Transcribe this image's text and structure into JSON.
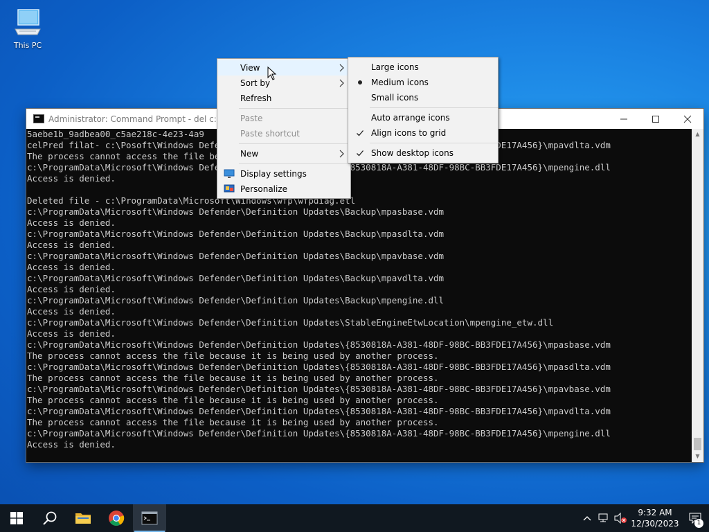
{
  "desktop": {
    "icons": [
      {
        "label": "This PC",
        "icon": "this-pc-icon"
      }
    ]
  },
  "cmd_window": {
    "title": "Administrator: Command Prompt - del  c:\\ /f /",
    "lines": [
      "5aebe1b_9adbea00_c5ae218c-4e23-4a9",
      "celPred filat- c:\\Posoft\\Windows Defender\\Definition Updates\\{8530818A-A381-48DF-98BC-BB3FDE17A456}\\mpavdlta.vdm",
      "The process cannot access the file because it is being used by another process.",
      "c:\\ProgramData\\Microsoft\\Windows Defender\\Definition Updates\\{8530818A-A381-48DF-98BC-BB3FDE17A456}\\mpengine.dll",
      "Access is denied.",
      "",
      "Deleted file - c:\\ProgramData\\Microsoft\\Windows\\wfp\\wfpdiag.etl",
      "c:\\ProgramData\\Microsoft\\Windows Defender\\Definition Updates\\Backup\\mpasbase.vdm",
      "Access is denied.",
      "c:\\ProgramData\\Microsoft\\Windows Defender\\Definition Updates\\Backup\\mpasdlta.vdm",
      "Access is denied.",
      "c:\\ProgramData\\Microsoft\\Windows Defender\\Definition Updates\\Backup\\mpavbase.vdm",
      "Access is denied.",
      "c:\\ProgramData\\Microsoft\\Windows Defender\\Definition Updates\\Backup\\mpavdlta.vdm",
      "Access is denied.",
      "c:\\ProgramData\\Microsoft\\Windows Defender\\Definition Updates\\Backup\\mpengine.dll",
      "Access is denied.",
      "c:\\ProgramData\\Microsoft\\Windows Defender\\Definition Updates\\StableEngineEtwLocation\\mpengine_etw.dll",
      "Access is denied.",
      "c:\\ProgramData\\Microsoft\\Windows Defender\\Definition Updates\\{8530818A-A381-48DF-98BC-BB3FDE17A456}\\mpasbase.vdm",
      "The process cannot access the file because it is being used by another process.",
      "c:\\ProgramData\\Microsoft\\Windows Defender\\Definition Updates\\{8530818A-A381-48DF-98BC-BB3FDE17A456}\\mpasdlta.vdm",
      "The process cannot access the file because it is being used by another process.",
      "c:\\ProgramData\\Microsoft\\Windows Defender\\Definition Updates\\{8530818A-A381-48DF-98BC-BB3FDE17A456}\\mpavbase.vdm",
      "The process cannot access the file because it is being used by another process.",
      "c:\\ProgramData\\Microsoft\\Windows Defender\\Definition Updates\\{8530818A-A381-48DF-98BC-BB3FDE17A456}\\mpavdlta.vdm",
      "The process cannot access the file because it is being used by another process.",
      "c:\\ProgramData\\Microsoft\\Windows Defender\\Definition Updates\\{8530818A-A381-48DF-98BC-BB3FDE17A456}\\mpengine.dll",
      "Access is denied."
    ],
    "colors": {
      "bg": "#0c0c0c",
      "fg": "#cccccc"
    }
  },
  "context_menu": {
    "items": [
      {
        "label": "View",
        "submenu": true,
        "hover": true
      },
      {
        "label": "Sort by",
        "submenu": true
      },
      {
        "label": "Refresh"
      },
      {
        "separator": true
      },
      {
        "label": "Paste",
        "disabled": true
      },
      {
        "label": "Paste shortcut",
        "disabled": true
      },
      {
        "separator": true
      },
      {
        "label": "New",
        "submenu": true
      },
      {
        "separator": true
      },
      {
        "label": "Display settings",
        "icon": "display-settings-icon"
      },
      {
        "label": "Personalize",
        "icon": "personalize-icon"
      }
    ]
  },
  "view_submenu": {
    "items": [
      {
        "label": "Large icons"
      },
      {
        "label": "Medium icons",
        "mark": "bullet"
      },
      {
        "label": "Small icons"
      },
      {
        "separator": true
      },
      {
        "label": "Auto arrange icons"
      },
      {
        "label": "Align icons to grid",
        "mark": "check"
      },
      {
        "separator": true
      },
      {
        "label": "Show desktop icons",
        "mark": "check"
      }
    ]
  },
  "taskbar": {
    "buttons": [
      {
        "name": "start-button",
        "icon": "windows-logo-icon"
      },
      {
        "name": "search-button",
        "icon": "search-icon"
      },
      {
        "name": "file-explorer-button",
        "icon": "folder-icon"
      },
      {
        "name": "chrome-button",
        "icon": "chrome-icon"
      },
      {
        "name": "cmd-taskbar-button",
        "icon": "cmd-icon",
        "active": true
      }
    ],
    "clock": {
      "time": "9:32 AM",
      "date": "12/30/2023"
    },
    "notification_count": "1",
    "accent": "#76b9ed"
  }
}
